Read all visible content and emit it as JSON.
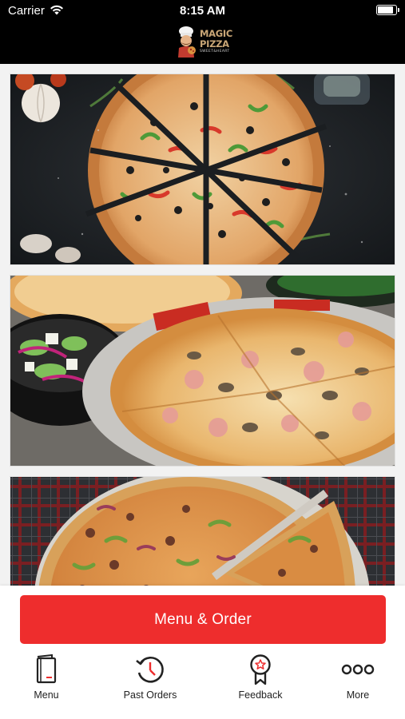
{
  "status_bar": {
    "carrier": "Carrier",
    "time": "8:15 AM"
  },
  "logo": {
    "line1": "MAGIC",
    "line2": "PIZZA",
    "line3": "SWEET&HEART"
  },
  "feed": {
    "images": [
      {
        "name": "pizza-photo-1",
        "depicts": "sliced pepperoni olive pepper pizza on dark stone"
      },
      {
        "name": "pizza-photo-2",
        "depicts": "mushroom ham pizza with salad bowl"
      },
      {
        "name": "pizza-photo-3",
        "depicts": "pepper onion beef pizza on tray"
      }
    ]
  },
  "actions": {
    "order_button": "Menu & Order"
  },
  "tab_bar": {
    "items": [
      {
        "label": "Menu",
        "icon": "menu-book-icon"
      },
      {
        "label": "Past Orders",
        "icon": "history-clock-icon"
      },
      {
        "label": "Feedback",
        "icon": "award-star-icon"
      },
      {
        "label": "More",
        "icon": "more-dots-icon"
      }
    ]
  },
  "colors": {
    "header_bg": "#000000",
    "accent": "#ee2d2d",
    "logo_gold": "#c9a676",
    "icon_dark": "#222222"
  }
}
